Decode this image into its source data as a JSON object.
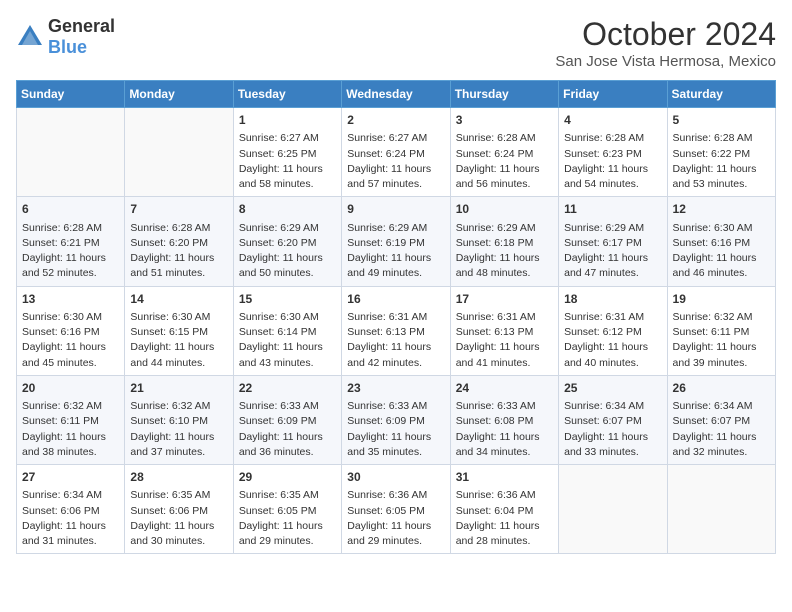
{
  "header": {
    "logo_general": "General",
    "logo_blue": "Blue",
    "month_title": "October 2024",
    "subtitle": "San Jose Vista Hermosa, Mexico"
  },
  "days_of_week": [
    "Sunday",
    "Monday",
    "Tuesday",
    "Wednesday",
    "Thursday",
    "Friday",
    "Saturday"
  ],
  "weeks": [
    [
      {
        "day": "",
        "empty": true
      },
      {
        "day": "",
        "empty": true
      },
      {
        "day": "1",
        "sunrise": "Sunrise: 6:27 AM",
        "sunset": "Sunset: 6:25 PM",
        "daylight": "Daylight: 11 hours and 58 minutes."
      },
      {
        "day": "2",
        "sunrise": "Sunrise: 6:27 AM",
        "sunset": "Sunset: 6:24 PM",
        "daylight": "Daylight: 11 hours and 57 minutes."
      },
      {
        "day": "3",
        "sunrise": "Sunrise: 6:28 AM",
        "sunset": "Sunset: 6:24 PM",
        "daylight": "Daylight: 11 hours and 56 minutes."
      },
      {
        "day": "4",
        "sunrise": "Sunrise: 6:28 AM",
        "sunset": "Sunset: 6:23 PM",
        "daylight": "Daylight: 11 hours and 54 minutes."
      },
      {
        "day": "5",
        "sunrise": "Sunrise: 6:28 AM",
        "sunset": "Sunset: 6:22 PM",
        "daylight": "Daylight: 11 hours and 53 minutes."
      }
    ],
    [
      {
        "day": "6",
        "sunrise": "Sunrise: 6:28 AM",
        "sunset": "Sunset: 6:21 PM",
        "daylight": "Daylight: 11 hours and 52 minutes."
      },
      {
        "day": "7",
        "sunrise": "Sunrise: 6:28 AM",
        "sunset": "Sunset: 6:20 PM",
        "daylight": "Daylight: 11 hours and 51 minutes."
      },
      {
        "day": "8",
        "sunrise": "Sunrise: 6:29 AM",
        "sunset": "Sunset: 6:20 PM",
        "daylight": "Daylight: 11 hours and 50 minutes."
      },
      {
        "day": "9",
        "sunrise": "Sunrise: 6:29 AM",
        "sunset": "Sunset: 6:19 PM",
        "daylight": "Daylight: 11 hours and 49 minutes."
      },
      {
        "day": "10",
        "sunrise": "Sunrise: 6:29 AM",
        "sunset": "Sunset: 6:18 PM",
        "daylight": "Daylight: 11 hours and 48 minutes."
      },
      {
        "day": "11",
        "sunrise": "Sunrise: 6:29 AM",
        "sunset": "Sunset: 6:17 PM",
        "daylight": "Daylight: 11 hours and 47 minutes."
      },
      {
        "day": "12",
        "sunrise": "Sunrise: 6:30 AM",
        "sunset": "Sunset: 6:16 PM",
        "daylight": "Daylight: 11 hours and 46 minutes."
      }
    ],
    [
      {
        "day": "13",
        "sunrise": "Sunrise: 6:30 AM",
        "sunset": "Sunset: 6:16 PM",
        "daylight": "Daylight: 11 hours and 45 minutes."
      },
      {
        "day": "14",
        "sunrise": "Sunrise: 6:30 AM",
        "sunset": "Sunset: 6:15 PM",
        "daylight": "Daylight: 11 hours and 44 minutes."
      },
      {
        "day": "15",
        "sunrise": "Sunrise: 6:30 AM",
        "sunset": "Sunset: 6:14 PM",
        "daylight": "Daylight: 11 hours and 43 minutes."
      },
      {
        "day": "16",
        "sunrise": "Sunrise: 6:31 AM",
        "sunset": "Sunset: 6:13 PM",
        "daylight": "Daylight: 11 hours and 42 minutes."
      },
      {
        "day": "17",
        "sunrise": "Sunrise: 6:31 AM",
        "sunset": "Sunset: 6:13 PM",
        "daylight": "Daylight: 11 hours and 41 minutes."
      },
      {
        "day": "18",
        "sunrise": "Sunrise: 6:31 AM",
        "sunset": "Sunset: 6:12 PM",
        "daylight": "Daylight: 11 hours and 40 minutes."
      },
      {
        "day": "19",
        "sunrise": "Sunrise: 6:32 AM",
        "sunset": "Sunset: 6:11 PM",
        "daylight": "Daylight: 11 hours and 39 minutes."
      }
    ],
    [
      {
        "day": "20",
        "sunrise": "Sunrise: 6:32 AM",
        "sunset": "Sunset: 6:11 PM",
        "daylight": "Daylight: 11 hours and 38 minutes."
      },
      {
        "day": "21",
        "sunrise": "Sunrise: 6:32 AM",
        "sunset": "Sunset: 6:10 PM",
        "daylight": "Daylight: 11 hours and 37 minutes."
      },
      {
        "day": "22",
        "sunrise": "Sunrise: 6:33 AM",
        "sunset": "Sunset: 6:09 PM",
        "daylight": "Daylight: 11 hours and 36 minutes."
      },
      {
        "day": "23",
        "sunrise": "Sunrise: 6:33 AM",
        "sunset": "Sunset: 6:09 PM",
        "daylight": "Daylight: 11 hours and 35 minutes."
      },
      {
        "day": "24",
        "sunrise": "Sunrise: 6:33 AM",
        "sunset": "Sunset: 6:08 PM",
        "daylight": "Daylight: 11 hours and 34 minutes."
      },
      {
        "day": "25",
        "sunrise": "Sunrise: 6:34 AM",
        "sunset": "Sunset: 6:07 PM",
        "daylight": "Daylight: 11 hours and 33 minutes."
      },
      {
        "day": "26",
        "sunrise": "Sunrise: 6:34 AM",
        "sunset": "Sunset: 6:07 PM",
        "daylight": "Daylight: 11 hours and 32 minutes."
      }
    ],
    [
      {
        "day": "27",
        "sunrise": "Sunrise: 6:34 AM",
        "sunset": "Sunset: 6:06 PM",
        "daylight": "Daylight: 11 hours and 31 minutes."
      },
      {
        "day": "28",
        "sunrise": "Sunrise: 6:35 AM",
        "sunset": "Sunset: 6:06 PM",
        "daylight": "Daylight: 11 hours and 30 minutes."
      },
      {
        "day": "29",
        "sunrise": "Sunrise: 6:35 AM",
        "sunset": "Sunset: 6:05 PM",
        "daylight": "Daylight: 11 hours and 29 minutes."
      },
      {
        "day": "30",
        "sunrise": "Sunrise: 6:36 AM",
        "sunset": "Sunset: 6:05 PM",
        "daylight": "Daylight: 11 hours and 29 minutes."
      },
      {
        "day": "31",
        "sunrise": "Sunrise: 6:36 AM",
        "sunset": "Sunset: 6:04 PM",
        "daylight": "Daylight: 11 hours and 28 minutes."
      },
      {
        "day": "",
        "empty": true
      },
      {
        "day": "",
        "empty": true
      }
    ]
  ]
}
